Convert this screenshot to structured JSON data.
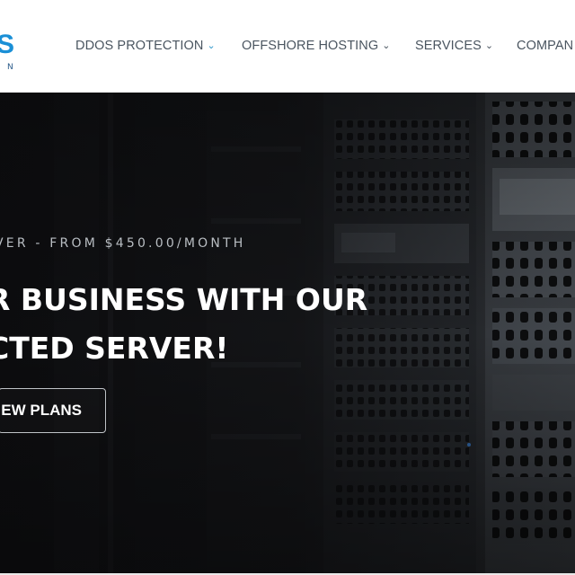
{
  "header": {
    "logo_text": "S",
    "logo_subtext": "N",
    "nav": [
      {
        "label": "DDOS PROTECTION",
        "icon": "chevron-down-icon"
      },
      {
        "label": "OFFSHORE HOSTING",
        "icon": "chevron-down-icon"
      },
      {
        "label": "SERVICES",
        "icon": "chevron-down-icon"
      },
      {
        "label": "COMPAN",
        "icon": ""
      }
    ]
  },
  "hero": {
    "kicker": "VER - FROM $450.00/MONTH",
    "title_line1": "R BUSINESS WITH OUR",
    "title_line2": "CTED SERVER!",
    "button_label": "EW PLANS"
  },
  "colors": {
    "accent": "#1a8fd6",
    "nav_text": "#4a5560",
    "hero_bg": "#0b0c0d"
  }
}
